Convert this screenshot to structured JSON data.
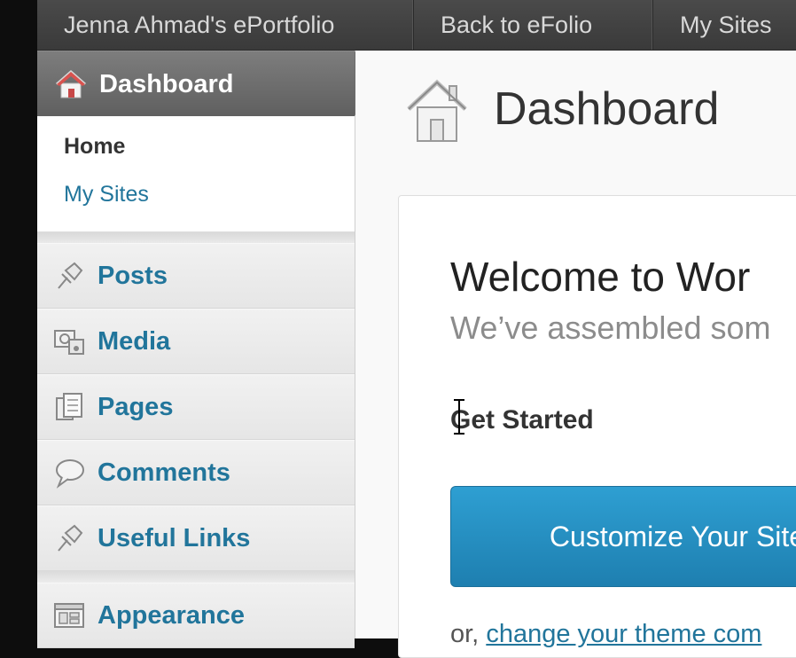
{
  "adminbar": {
    "items": [
      "Jenna Ahmad's ePortfolio",
      "Back to eFolio",
      "My Sites"
    ]
  },
  "sidebar": {
    "dashboard_label": "Dashboard",
    "submenu": {
      "home": "Home",
      "my_sites": "My Sites"
    },
    "items": [
      {
        "label": "Posts",
        "icon": "pushpin-icon"
      },
      {
        "label": "Media",
        "icon": "media-icon"
      },
      {
        "label": "Pages",
        "icon": "pages-icon"
      },
      {
        "label": "Comments",
        "icon": "comment-bubble-icon"
      },
      {
        "label": "Useful Links",
        "icon": "pushpin-icon"
      },
      {
        "label": "Appearance",
        "icon": "appearance-icon"
      }
    ]
  },
  "main": {
    "title": "Dashboard",
    "welcome": "Welcome to Wor",
    "subwelcome": "We’ve assembled som",
    "get_started": "Get Started",
    "cta_label": "Customize Your Site",
    "bottom_prefix": "or, ",
    "bottom_link": "change your theme com"
  },
  "colors": {
    "link": "#21759b",
    "cta_blue": "#2e9fd2",
    "adminbar": "#464646",
    "menu_head": "#6d6d6d"
  }
}
